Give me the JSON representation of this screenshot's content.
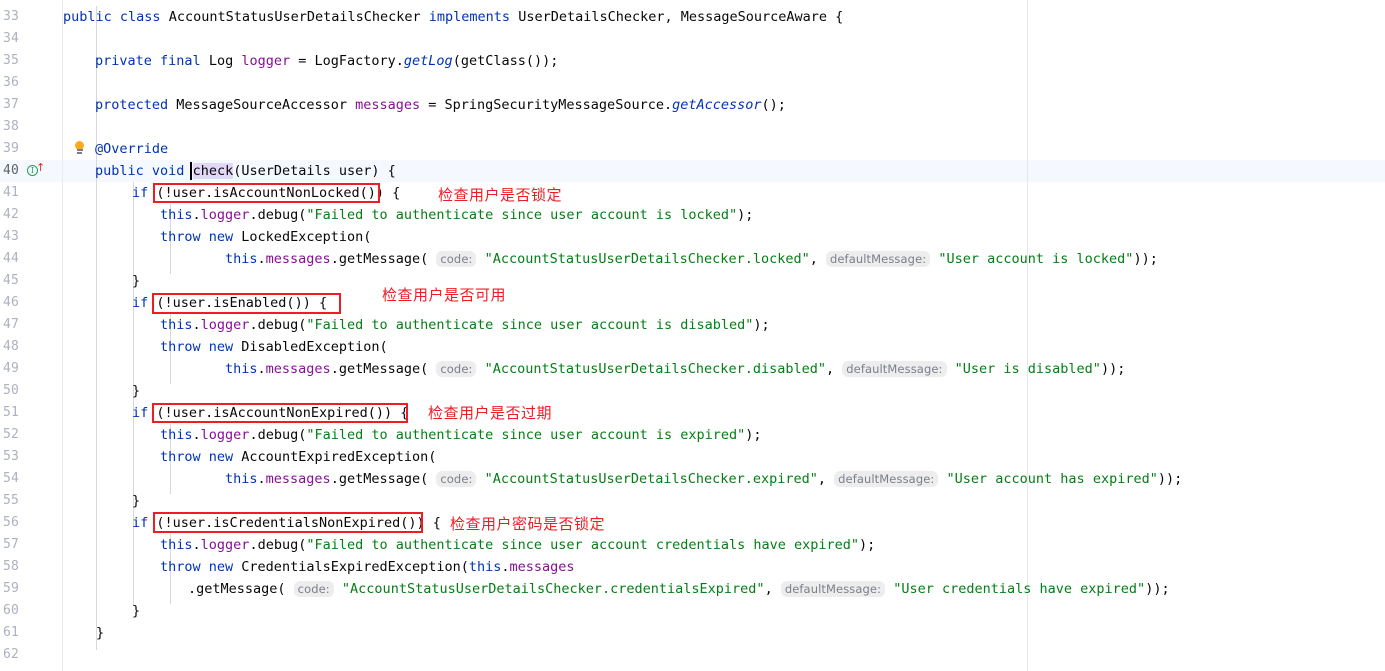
{
  "editor": {
    "first_line_number": 33,
    "last_line_number": 62,
    "current_line_number": 40,
    "right_margin_column_guide": true,
    "colors": {
      "background": "#ffffff",
      "keyword": "#0033b3",
      "string": "#067d17",
      "field": "#871094",
      "plain_text": "#080808",
      "line_number": "#adb1c0",
      "current_line_background": "#f5f8fe",
      "inlay_hint_background": "#ededee",
      "inlay_hint_text": "#7a7f8a",
      "annotation_red": "#ee1c25",
      "identifier_highlight": "#e2d7f7",
      "indent_guide": "#d8d8dc",
      "gutter_separator": "#e9eaec"
    },
    "gutter_icons": [
      {
        "line": 39,
        "name": "intention-lightbulb-icon",
        "glyph": "lightbulb"
      },
      {
        "line": 40,
        "name": "implementing-method-marker-icon",
        "glyph": "circled-I-with-up-arrow"
      }
    ],
    "lines": [
      {
        "n": 33,
        "text": "public class AccountStatusUserDetailsChecker implements UserDetailsChecker, MessageSourceAware {"
      },
      {
        "n": 34,
        "text": ""
      },
      {
        "n": 35,
        "text": "    private final Log logger = LogFactory.getLog(getClass());"
      },
      {
        "n": 36,
        "text": ""
      },
      {
        "n": 37,
        "text": "    protected MessageSourceAccessor messages = SpringSecurityMessageSource.getAccessor();"
      },
      {
        "n": 38,
        "text": ""
      },
      {
        "n": 39,
        "text": "    @Override"
      },
      {
        "n": 40,
        "text": "    public void check(UserDetails user) {"
      },
      {
        "n": 41,
        "text": "        if (!user.isAccountNonLocked()) {"
      },
      {
        "n": 42,
        "text": "            this.logger.debug(\"Failed to authenticate since user account is locked\");"
      },
      {
        "n": 43,
        "text": "            throw new LockedException("
      },
      {
        "n": 44,
        "text": "                    this.messages.getMessage( code: \"AccountStatusUserDetailsChecker.locked\",  defaultMessage: \"User account is locked\"));"
      },
      {
        "n": 45,
        "text": "        }"
      },
      {
        "n": 46,
        "text": "        if (!user.isEnabled()) {"
      },
      {
        "n": 47,
        "text": "            this.logger.debug(\"Failed to authenticate since user account is disabled\");"
      },
      {
        "n": 48,
        "text": "            throw new DisabledException("
      },
      {
        "n": 49,
        "text": "                    this.messages.getMessage( code: \"AccountStatusUserDetailsChecker.disabled\",  defaultMessage: \"User is disabled\"));"
      },
      {
        "n": 50,
        "text": "        }"
      },
      {
        "n": 51,
        "text": "        if (!user.isAccountNonExpired()) {"
      },
      {
        "n": 52,
        "text": "            this.logger.debug(\"Failed to authenticate since user account is expired\");"
      },
      {
        "n": 53,
        "text": "            throw new AccountExpiredException("
      },
      {
        "n": 54,
        "text": "                    this.messages.getMessage( code: \"AccountStatusUserDetailsChecker.expired\",  defaultMessage: \"User account has expired\"));"
      },
      {
        "n": 55,
        "text": "        }"
      },
      {
        "n": 56,
        "text": "        if (!user.isCredentialsNonExpired()) {"
      },
      {
        "n": 57,
        "text": "            this.logger.debug(\"Failed to authenticate since user account credentials have expired\");"
      },
      {
        "n": 58,
        "text": "            throw new CredentialsExpiredException(this.messages"
      },
      {
        "n": 59,
        "text": "                .getMessage( code: \"AccountStatusUserDetailsChecker.credentialsExpired\",  defaultMessage: \"User credentials have expired\"));"
      },
      {
        "n": 60,
        "text": "        }"
      },
      {
        "n": 61,
        "text": "    }"
      },
      {
        "n": 62,
        "text": ""
      }
    ],
    "inlay_hints": [
      {
        "line": 44,
        "label": "code:"
      },
      {
        "line": 44,
        "label": "defaultMessage:"
      },
      {
        "line": 49,
        "label": "code:"
      },
      {
        "line": 49,
        "label": "defaultMessage:"
      },
      {
        "line": 54,
        "label": "code:"
      },
      {
        "line": 54,
        "label": "defaultMessage:"
      },
      {
        "line": 59,
        "label": "code:"
      },
      {
        "line": 59,
        "label": "defaultMessage:"
      }
    ],
    "annotations": [
      {
        "line": 41,
        "boxed_code": "(!user.isAccountNonLocked())",
        "text": "检查用户是否锁定"
      },
      {
        "line": 46,
        "boxed_code": "(!user.isEnabled()) {",
        "text": "检查用户是否可用"
      },
      {
        "line": 51,
        "boxed_code": "(!user.isAccountNonExpired()) {",
        "text": "检查用户是否过期"
      },
      {
        "line": 56,
        "boxed_code": "(!user.isCredentialsNonExpired())",
        "text": "检查用户密码是否锁定"
      }
    ],
    "caret": {
      "line": 40,
      "before_token": "check"
    },
    "highlighted_identifier": "check"
  }
}
